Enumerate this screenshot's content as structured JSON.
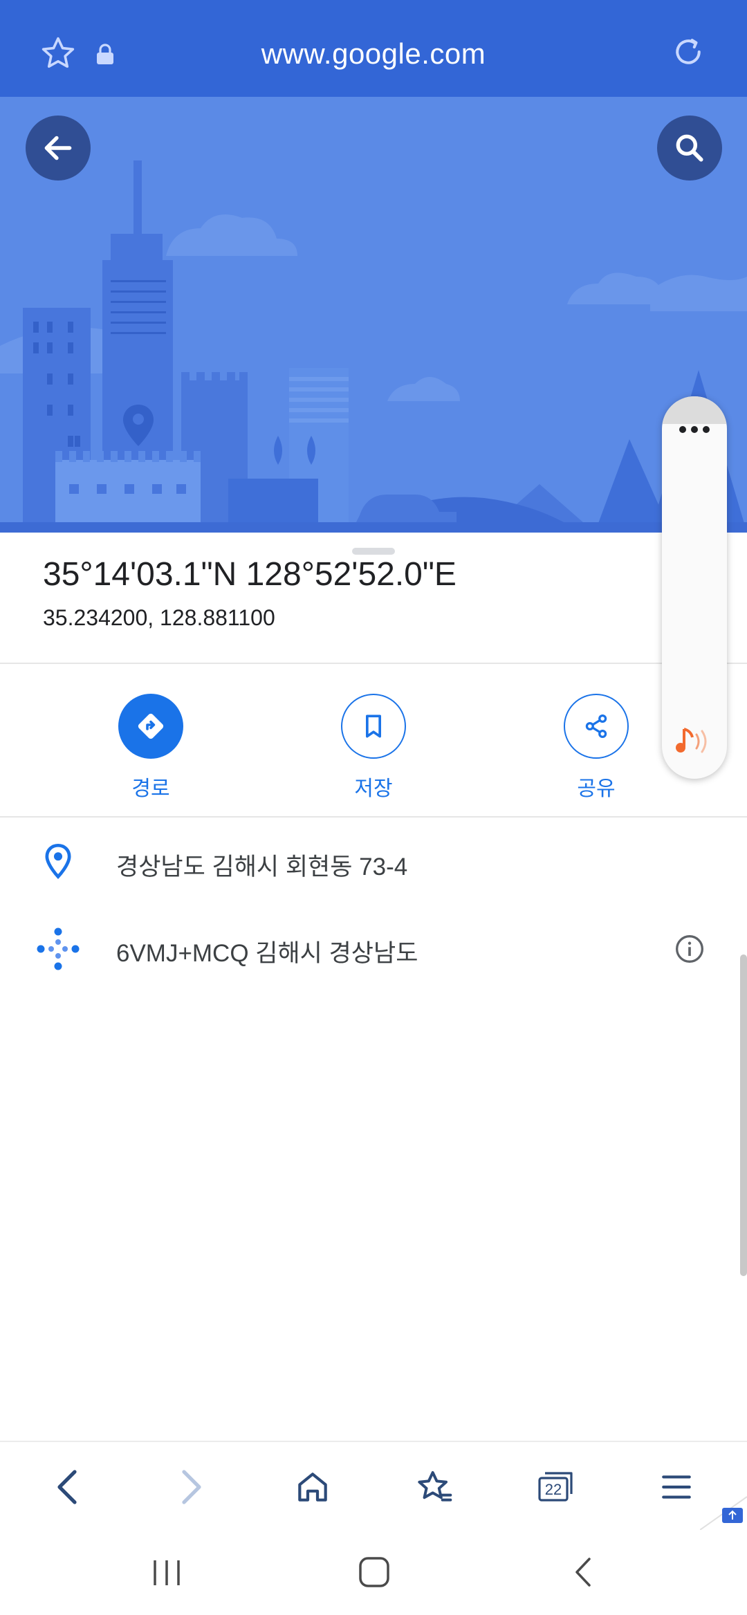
{
  "browser": {
    "url": "www.google.com",
    "tab_count": "22"
  },
  "place": {
    "dms": "35°14'03.1\"N 128°52'52.0\"E",
    "decimal": "35.234200, 128.881100"
  },
  "actions": [
    {
      "label": "경로",
      "icon": "directions-icon"
    },
    {
      "label": "저장",
      "icon": "bookmark-icon"
    },
    {
      "label": "공유",
      "icon": "share-icon"
    }
  ],
  "info": {
    "address": "경상남도 김해시 회현동 73-4",
    "plus_code": "6VMJ+MCQ 김해시 경상남도"
  },
  "colors": {
    "browser_bar": "#3366d6",
    "hero_bg": "#5b8ae6",
    "accent": "#1a73e8",
    "round_button": "#304e94"
  }
}
